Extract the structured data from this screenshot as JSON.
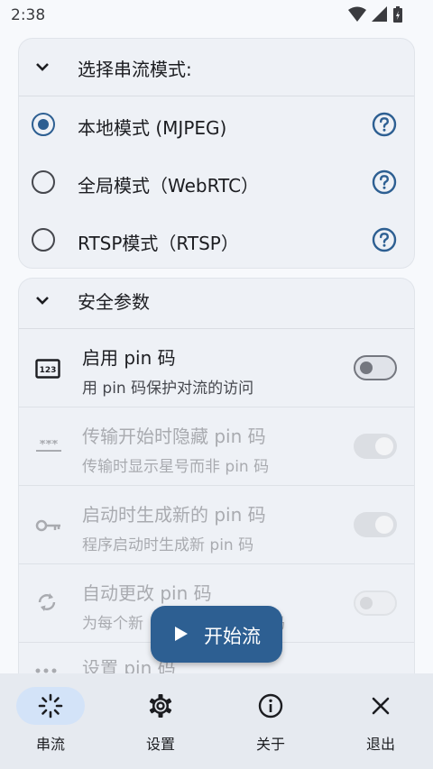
{
  "status_bar": {
    "time": "2:38"
  },
  "stream_mode": {
    "header": "选择串流模式:",
    "options": [
      {
        "label": "本地模式 (MJPEG)",
        "selected": true
      },
      {
        "label": "全局模式（WebRTC）",
        "selected": false
      },
      {
        "label": "RTSP模式（RTSP）",
        "selected": false
      }
    ]
  },
  "security": {
    "header": "安全参数",
    "items": [
      {
        "title": "启用 pin 码",
        "subtitle": "用 pin 码保护对流的访问",
        "enabled": true,
        "on": false
      },
      {
        "title": "传输开始时隐藏 pin 码",
        "subtitle": "传输时显示星号而非 pin 码",
        "enabled": false,
        "on": true
      },
      {
        "title": "启动时生成新的 pin 码",
        "subtitle": "程序启动时生成新 pin 码",
        "enabled": false,
        "on": true
      },
      {
        "title": "自动更改 pin 码",
        "subtitle": "为每个新",
        "subtitle_tail": "码",
        "enabled": false,
        "on": false
      },
      {
        "title": "设置 pin 码"
      }
    ]
  },
  "fab": {
    "label": "开始流"
  },
  "bottom_nav": [
    {
      "label": "串流",
      "icon": "stream-icon",
      "active": true
    },
    {
      "label": "设置",
      "icon": "gear-icon",
      "active": false
    },
    {
      "label": "关于",
      "icon": "info-icon",
      "active": false
    },
    {
      "label": "退出",
      "icon": "close-icon",
      "active": false
    }
  ],
  "colors": {
    "accent": "#2d5f92",
    "surface": "#eef1f6",
    "nav_bg": "#e6eaf0",
    "nav_active": "#d3e3f8"
  }
}
